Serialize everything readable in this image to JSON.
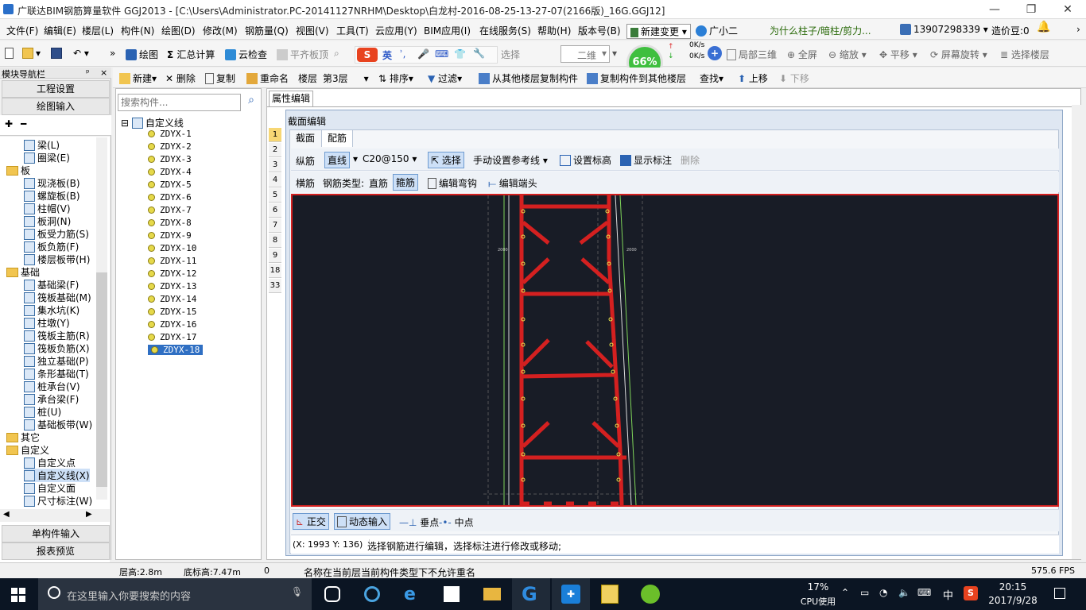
{
  "window": {
    "title": "广联达BIM钢筋算量软件 GGJ2013 - [C:\\Users\\Administrator.PC-20141127NRHM\\Desktop\\白龙村-2016-08-25-13-27-07(2166版)_16G.GGJ12]",
    "minimize": "—",
    "restore": "❐",
    "close": "✕"
  },
  "menu": {
    "items": [
      "文件(F)",
      "编辑(E)",
      "楼层(L)",
      "构件(N)",
      "绘图(D)",
      "修改(M)",
      "钢筋量(Q)",
      "视图(V)",
      "工具(T)",
      "云应用(Y)",
      "BIM应用(I)",
      "在线服务(S)",
      "帮助(H)",
      "版本号(B)"
    ],
    "new_change": "新建变更",
    "assistant": "广小二",
    "question": "为什么柱子/暗柱/剪力...",
    "phone": "13907298339",
    "beans": "造价豆:0"
  },
  "toolbar1": {
    "draw": "绘图",
    "sum": "汇总计算",
    "cloud_check": "云检查",
    "level_top": "平齐板顶",
    "select_tail": "选择",
    "view_mode": "二维",
    "cpu_pct": "66%",
    "up_speed": "0K/s",
    "down_speed": "0K/s",
    "local3d": "局部三维",
    "fullscreen": "全屏",
    "zoom": "缩放",
    "pan": "平移",
    "rotate": "屏幕旋转",
    "select_floor": "选择楼层",
    "ime_en": "英"
  },
  "toolbar2": {
    "new": "新建",
    "delete": "删除",
    "copy": "复制",
    "rename": "重命名",
    "floor_label": "楼层",
    "floor_value": "第3层",
    "sort": "排序",
    "filter": "过滤",
    "copy_from": "从其他楼层复制构件",
    "copy_to": "复制构件到其他楼层",
    "find": "查找",
    "move_up": "上移",
    "move_down": "下移"
  },
  "nav": {
    "header": "模块导航栏",
    "pin": "ᵖ",
    "close": "×",
    "project_settings": "工程设置",
    "draw_input": "绘图输入",
    "single_input": "单构件输入",
    "report": "报表预览",
    "tree": [
      {
        "type": "item",
        "label": "梁(L)",
        "indent": 2
      },
      {
        "type": "item",
        "label": "圈梁(E)",
        "indent": 2
      },
      {
        "type": "folder",
        "label": "板",
        "indent": 1
      },
      {
        "type": "item",
        "label": "现浇板(B)",
        "indent": 2
      },
      {
        "type": "item",
        "label": "螺旋板(B)",
        "indent": 2
      },
      {
        "type": "item",
        "label": "柱帽(V)",
        "indent": 2
      },
      {
        "type": "item",
        "label": "板洞(N)",
        "indent": 2
      },
      {
        "type": "item",
        "label": "板受力筋(S)",
        "indent": 2
      },
      {
        "type": "item",
        "label": "板负筋(F)",
        "indent": 2
      },
      {
        "type": "item",
        "label": "楼层板带(H)",
        "indent": 2
      },
      {
        "type": "folder",
        "label": "基础",
        "indent": 1
      },
      {
        "type": "item",
        "label": "基础梁(F)",
        "indent": 2
      },
      {
        "type": "item",
        "label": "筏板基础(M)",
        "indent": 2
      },
      {
        "type": "item",
        "label": "集水坑(K)",
        "indent": 2
      },
      {
        "type": "item",
        "label": "柱墩(Y)",
        "indent": 2
      },
      {
        "type": "item",
        "label": "筏板主筋(R)",
        "indent": 2
      },
      {
        "type": "item",
        "label": "筏板负筋(X)",
        "indent": 2
      },
      {
        "type": "item",
        "label": "独立基础(P)",
        "indent": 2
      },
      {
        "type": "item",
        "label": "条形基础(T)",
        "indent": 2
      },
      {
        "type": "item",
        "label": "桩承台(V)",
        "indent": 2
      },
      {
        "type": "item",
        "label": "承台梁(F)",
        "indent": 2
      },
      {
        "type": "item",
        "label": "桩(U)",
        "indent": 2
      },
      {
        "type": "item",
        "label": "基础板带(W)",
        "indent": 2
      },
      {
        "type": "folder",
        "label": "其它",
        "indent": 1
      },
      {
        "type": "folder",
        "label": "自定义",
        "indent": 1
      },
      {
        "type": "item",
        "label": "自定义点",
        "indent": 2
      },
      {
        "type": "item",
        "label": "自定义线(X)",
        "indent": 2,
        "selected": true
      },
      {
        "type": "item",
        "label": "自定义面",
        "indent": 2
      },
      {
        "type": "item",
        "label": "尺寸标注(W)",
        "indent": 2
      }
    ]
  },
  "list": {
    "search_placeholder": "搜索构件...",
    "root": "自定义线",
    "items": [
      "ZDYX-1",
      "ZDYX-2",
      "ZDYX-3",
      "ZDYX-4",
      "ZDYX-5",
      "ZDYX-6",
      "ZDYX-7",
      "ZDYX-8",
      "ZDYX-9",
      "ZDYX-10",
      "ZDYX-11",
      "ZDYX-12",
      "ZDYX-13",
      "ZDYX-14",
      "ZDYX-15",
      "ZDYX-16",
      "ZDYX-17",
      "ZDYX-18"
    ],
    "selected": "ZDYX-18"
  },
  "props": {
    "tab": "属性编辑",
    "rows": [
      "1",
      "2",
      "3",
      "4",
      "5",
      "6",
      "7",
      "8",
      "9",
      "18",
      "33"
    ]
  },
  "dialog": {
    "title": "截面编辑",
    "tab_section": "截面",
    "tab_rebar": "配筋",
    "long_bar": "纵筋",
    "line": "直线",
    "spec": "C20@150",
    "select": "选择",
    "manual_ref": "手动设置参考线",
    "set_elev": "设置标高",
    "show_mark": "显示标注",
    "delete": "删除",
    "trans_bar": "横筋",
    "rebar_type_label": "钢筋类型:",
    "straight": "直筋",
    "stirrup": "箍筋",
    "edit_hook": "编辑弯钩",
    "edit_end": "编辑端头",
    "ortho": "正交",
    "dyn_input": "动态输入",
    "perp": "垂点",
    "mid": "中点",
    "coords": "(X: 1993 Y: 136)",
    "hint": "选择钢筋进行编辑，选择标注进行修改或移动;",
    "dim_left": "2000",
    "dim_right": "2000"
  },
  "status": {
    "floor_height": "层高:2.8m",
    "base_elev": "底标高:7.47m",
    "count": "0",
    "message": "名称在当前层当前构件类型下不允许重名",
    "fps": "575.6 FPS"
  },
  "taskbar": {
    "search_placeholder": "在这里输入你要搜索的内容",
    "cpu_pct": "17%",
    "cpu_label": "CPU使用",
    "lang": "中",
    "time": "20:15",
    "date": "2017/9/28"
  },
  "colors": {
    "canvas_bg": "#181c26",
    "rebar_red": "#d42020",
    "guide_green": "#7fd45a",
    "cpu_green": "#3fbf3f",
    "selection_blue": "#2f6fc3"
  }
}
